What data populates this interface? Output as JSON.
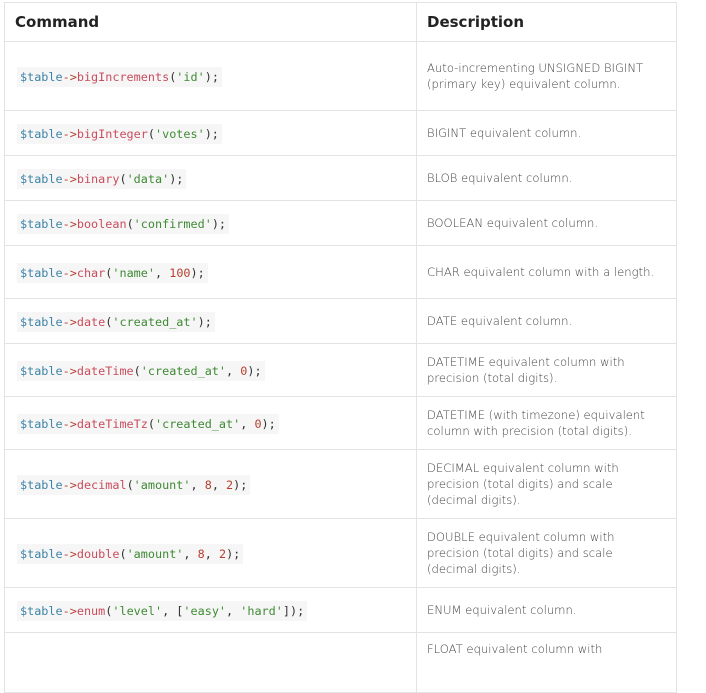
{
  "headers": {
    "command": "Command",
    "description": "Description"
  },
  "rows": [
    {
      "tokens": [
        [
          "var",
          "$table"
        ],
        [
          "arw",
          "->"
        ],
        [
          "fn",
          "bigIncrements"
        ],
        [
          "pn",
          "("
        ],
        [
          "str",
          "'id'"
        ],
        [
          "pn",
          ");"
        ]
      ],
      "desc": "Auto-incrementing UNSIGNED BIGINT (primary key) equivalent column."
    },
    {
      "tokens": [
        [
          "var",
          "$table"
        ],
        [
          "arw",
          "->"
        ],
        [
          "fn",
          "bigInteger"
        ],
        [
          "pn",
          "("
        ],
        [
          "str",
          "'votes'"
        ],
        [
          "pn",
          ");"
        ]
      ],
      "desc": "BIGINT equivalent column."
    },
    {
      "tokens": [
        [
          "var",
          "$table"
        ],
        [
          "arw",
          "->"
        ],
        [
          "fn",
          "binary"
        ],
        [
          "pn",
          "("
        ],
        [
          "str",
          "'data'"
        ],
        [
          "pn",
          ");"
        ]
      ],
      "desc": "BLOB equivalent column."
    },
    {
      "tokens": [
        [
          "var",
          "$table"
        ],
        [
          "arw",
          "->"
        ],
        [
          "fn",
          "boolean"
        ],
        [
          "pn",
          "("
        ],
        [
          "str",
          "'confirmed'"
        ],
        [
          "pn",
          ");"
        ]
      ],
      "desc": "BOOLEAN equivalent column."
    },
    {
      "tokens": [
        [
          "var",
          "$table"
        ],
        [
          "arw",
          "->"
        ],
        [
          "fn",
          "char"
        ],
        [
          "pn",
          "("
        ],
        [
          "str",
          "'name'"
        ],
        [
          "pn",
          ", "
        ],
        [
          "num",
          "100"
        ],
        [
          "pn",
          ");"
        ]
      ],
      "desc": "CHAR equivalent column with a length."
    },
    {
      "tokens": [
        [
          "var",
          "$table"
        ],
        [
          "arw",
          "->"
        ],
        [
          "fn",
          "date"
        ],
        [
          "pn",
          "("
        ],
        [
          "str",
          "'created_at'"
        ],
        [
          "pn",
          ");"
        ]
      ],
      "desc": "DATE equivalent column."
    },
    {
      "tokens": [
        [
          "var",
          "$table"
        ],
        [
          "arw",
          "->"
        ],
        [
          "fn",
          "dateTime"
        ],
        [
          "pn",
          "("
        ],
        [
          "str",
          "'created_at'"
        ],
        [
          "pn",
          ", "
        ],
        [
          "num",
          "0"
        ],
        [
          "pn",
          ");"
        ]
      ],
      "desc": "DATETIME equivalent column with precision (total digits)."
    },
    {
      "tokens": [
        [
          "var",
          "$table"
        ],
        [
          "arw",
          "->"
        ],
        [
          "fn",
          "dateTimeTz"
        ],
        [
          "pn",
          "("
        ],
        [
          "str",
          "'created_at'"
        ],
        [
          "pn",
          ", "
        ],
        [
          "num",
          "0"
        ],
        [
          "pn",
          ");"
        ]
      ],
      "desc": "DATETIME (with timezone) equivalent column with precision (total digits)."
    },
    {
      "tokens": [
        [
          "var",
          "$table"
        ],
        [
          "arw",
          "->"
        ],
        [
          "fn",
          "decimal"
        ],
        [
          "pn",
          "("
        ],
        [
          "str",
          "'amount'"
        ],
        [
          "pn",
          ", "
        ],
        [
          "num",
          "8"
        ],
        [
          "pn",
          ", "
        ],
        [
          "num",
          "2"
        ],
        [
          "pn",
          ");"
        ]
      ],
      "desc": "DECIMAL equivalent column with precision (total digits) and scale (decimal digits)."
    },
    {
      "tokens": [
        [
          "var",
          "$table"
        ],
        [
          "arw",
          "->"
        ],
        [
          "fn",
          "double"
        ],
        [
          "pn",
          "("
        ],
        [
          "str",
          "'amount'"
        ],
        [
          "pn",
          ", "
        ],
        [
          "num",
          "8"
        ],
        [
          "pn",
          ", "
        ],
        [
          "num",
          "2"
        ],
        [
          "pn",
          ");"
        ]
      ],
      "desc": "DOUBLE equivalent column with precision (total digits) and scale (decimal digits)."
    },
    {
      "tokens": [
        [
          "var",
          "$table"
        ],
        [
          "arw",
          "->"
        ],
        [
          "fn",
          "enum"
        ],
        [
          "pn",
          "("
        ],
        [
          "str",
          "'level'"
        ],
        [
          "pn",
          ", ["
        ],
        [
          "str",
          "'easy'"
        ],
        [
          "pn",
          ", "
        ],
        [
          "str",
          "'hard'"
        ],
        [
          "pn",
          "]);"
        ]
      ],
      "desc": "ENUM equivalent column."
    },
    {
      "tokens": [],
      "desc": "FLOAT equivalent column with"
    }
  ]
}
